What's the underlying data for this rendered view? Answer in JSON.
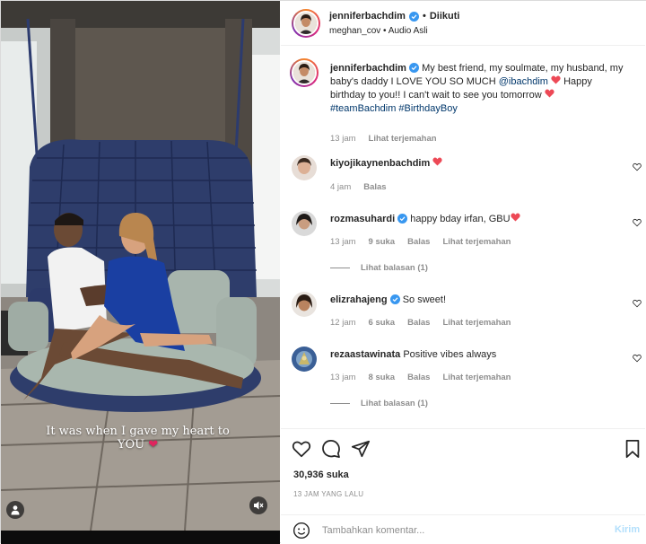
{
  "post": {
    "author": "jenniferbachdim",
    "follow_status": "Diikuti",
    "separator": "•",
    "audio_source": "meghan_cov",
    "audio_separator": "•",
    "audio_label": "Audio Asli",
    "video_overlay_line1": "It was when I gave my heart to",
    "video_overlay_line2": "YOU",
    "video_overlay_heart": "❤"
  },
  "caption": {
    "username": "jenniferbachdim",
    "text_part1": "My best friend, my soulmate, my husband, my baby's daddy I LOVE YOU SO MUCH ",
    "mention": "@ibachdim",
    "text_part2": " Happy birthday to you!! I can't wait to see you tomorrow ",
    "hashtags": "#teamBachdim #BirthdayBoy",
    "time": "13 jam",
    "translate": "Lihat terjemahan"
  },
  "comments": [
    {
      "username": "kiyojikaynenbachdim",
      "text": "",
      "time": "4 jam",
      "likes": "",
      "reply": "Balas",
      "translate": "",
      "verified": false
    },
    {
      "username": "rozmasuhardi",
      "text": "happy bday irfan, GBU",
      "time": "13 jam",
      "likes": "9 suka",
      "reply": "Balas",
      "translate": "Lihat terjemahan",
      "view_replies": "Lihat balasan (1)",
      "verified": true
    },
    {
      "username": "elizrahajeng",
      "text": "So sweet!",
      "time": "12 jam",
      "likes": "6 suka",
      "reply": "Balas",
      "translate": "Lihat terjemahan",
      "verified": true
    },
    {
      "username": "rezaastawinata",
      "text": "Positive vibes always",
      "time": "13 jam",
      "likes": "8 suka",
      "reply": "Balas",
      "translate": "Lihat terjemahan",
      "view_replies": "Lihat balasan (1)",
      "verified": false
    }
  ],
  "stats": {
    "likes": "30,936 suka",
    "time_ago": "13 JAM YANG LALU"
  },
  "add_comment": {
    "placeholder": "Tambahkan komentar...",
    "post_label": "Kirim"
  },
  "colors": {
    "heart_red": "#ed4956",
    "verified_blue": "#3897f0",
    "link_blue": "#00376b",
    "muted_gray": "#8e8e8e",
    "post_button_disabled": "#b2dffc"
  },
  "icons": {
    "like": "heart-outline-icon",
    "comment": "comment-bubble-icon",
    "share": "paper-plane-icon",
    "save": "bookmark-icon",
    "emoji": "smiley-icon",
    "mute": "speaker-muted-icon",
    "tag": "user-tag-icon"
  }
}
